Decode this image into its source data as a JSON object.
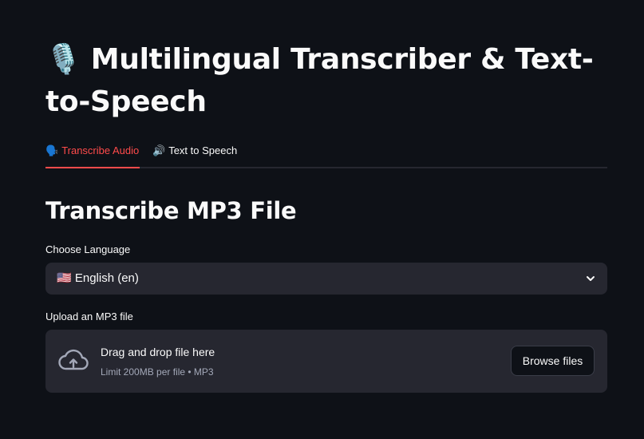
{
  "app": {
    "title_icon": "🎙️",
    "title": "Multilingual Transcriber & Text-to-Speech"
  },
  "tabs": [
    {
      "icon": "🗣️",
      "label": "Transcribe Audio",
      "active": true
    },
    {
      "icon": "🔊",
      "label": "Text to Speech",
      "active": false
    }
  ],
  "section": {
    "heading": "Transcribe MP3 File"
  },
  "language": {
    "label": "Choose Language",
    "selected": "🇺🇸 English (en)"
  },
  "upload": {
    "label": "Upload an MP3 file",
    "drop_text": "Drag and drop file here",
    "limit_text": "Limit 200MB per file • MP3",
    "browse_label": "Browse files"
  },
  "colors": {
    "background": "#0e1117",
    "surface": "#262730",
    "accent": "#ff4b4b",
    "text": "#fafafa",
    "muted": "#a3a8b8"
  }
}
